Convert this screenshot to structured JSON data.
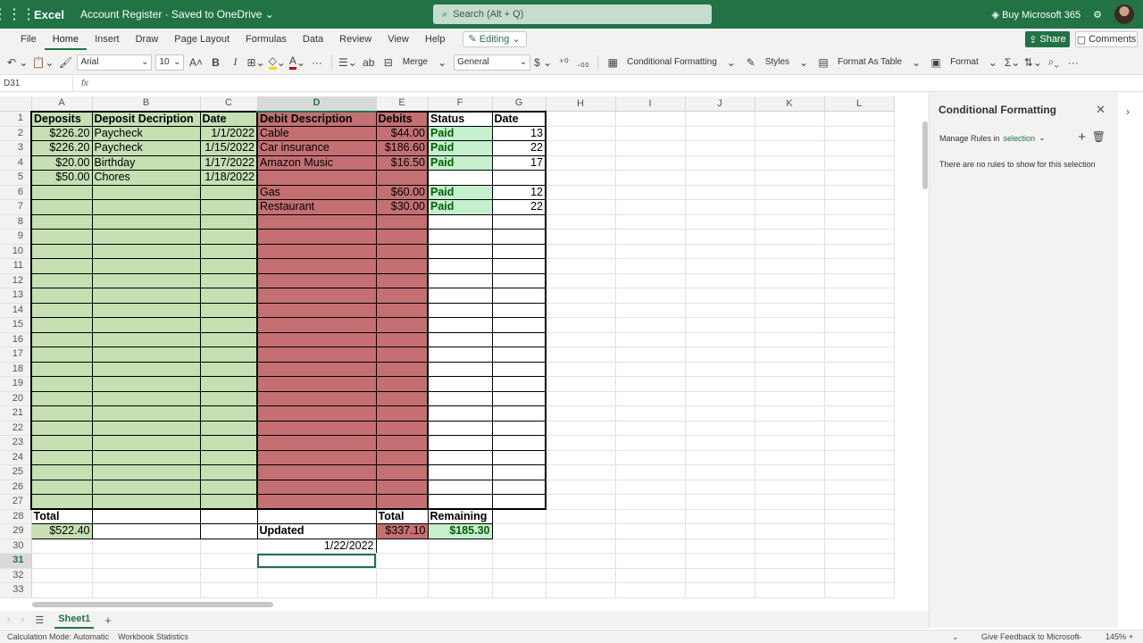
{
  "titlebar": {
    "app_name": "Excel",
    "doc_title": "Account Register  ·  Saved to OneDrive ⌄",
    "search_placeholder": "Search (Alt + Q)",
    "buy_label": "Buy Microsoft 365"
  },
  "ribbon": {
    "tabs": [
      "File",
      "Home",
      "Insert",
      "Draw",
      "Page Layout",
      "Formulas",
      "Data",
      "Review",
      "View",
      "Help"
    ],
    "active_tab": "Home",
    "editing_label": "Editing",
    "share_label": "Share",
    "comments_label": "Comments"
  },
  "toolbar": {
    "font_name": "Arial",
    "font_size": "10",
    "merge_label": "Merge",
    "number_format": "General",
    "conditional_formatting_label": "Conditional Formatting",
    "styles_label": "Styles",
    "format_as_table_label": "Format As Table",
    "format_label": "Format"
  },
  "formula_bar": {
    "name_box": "D31",
    "fx": "fx",
    "content": ""
  },
  "grid": {
    "columns": [
      "A",
      "B",
      "C",
      "D",
      "E",
      "F",
      "G",
      "H",
      "I",
      "J",
      "K",
      "L"
    ],
    "selected_column": "D",
    "selected_row": 31,
    "row_count": 33,
    "cells": {
      "A1": "Deposits",
      "B1": "Deposit Decription",
      "C1": "Date",
      "D1": "Debit Description",
      "E1": "Debits",
      "F1": "Status",
      "G1": "Date",
      "A2": "$226.20",
      "B2": "Paycheck",
      "C2": "1/1/2022",
      "D2": "Cable",
      "E2": "$44.00",
      "F2": "Paid",
      "G2": "13",
      "A3": "$226.20",
      "B3": "Paycheck",
      "C3": "1/15/2022",
      "D3": "Car insurance",
      "E3": "$186.60",
      "F3": "Paid",
      "G3": "22",
      "A4": "$20.00",
      "B4": "Birthday",
      "C4": "1/17/2022",
      "D4": "Amazon Music",
      "E4": "$16.50",
      "F4": "Paid",
      "G4": "17",
      "A5": "$50.00",
      "B5": "Chores",
      "C5": "1/18/2022",
      "D6": "Gas",
      "E6": "$60.00",
      "F6": "Paid",
      "G6": "12",
      "D7": "Restaurant",
      "E7": "$30.00",
      "F7": "Paid",
      "G7": "22",
      "A28": "Total",
      "E28": "Total",
      "F28": "Remaining",
      "A29": "$522.40",
      "D29": "Updated",
      "E29": "$337.10",
      "F29": "$185.30",
      "D30": "1/22/2022"
    }
  },
  "pane": {
    "title": "Conditional Formatting",
    "manage_label": "Manage Rules in",
    "manage_scope": "selection",
    "empty_message": "There are no rules to show for this selection"
  },
  "sheets": {
    "active": "Sheet1"
  },
  "status": {
    "calc_mode": "Calculation Mode: Automatic",
    "workbook_stats": "Workbook Statistics",
    "feedback": "Give Feedback to Microsoft",
    "zoom": "145%"
  },
  "colors": {
    "brand": "#217346",
    "deposit_fill": "#c6e0b4",
    "debit_fill": "#c47073",
    "paid_fill": "#c6efce",
    "paid_text": "#006100"
  }
}
